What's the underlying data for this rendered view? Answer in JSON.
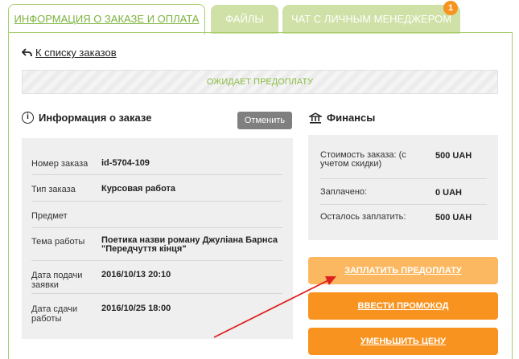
{
  "tabs": {
    "order_info": "ИНФОРМАЦИЯ О ЗАКАЗЕ И ОПЛАТА",
    "files": "ФАЙЛЫ",
    "chat": "ЧАТ С ЛИЧНЫМ МЕНЕДЖЕРОМ",
    "chat_badge": "1"
  },
  "back_link": "К списку заказов",
  "status": "ОЖИДАЕТ ПРЕДОПЛАТУ",
  "order_section": {
    "title": "Информация о заказе",
    "cancel": "Отменить",
    "rows": [
      {
        "label": "Номер заказа",
        "value": "id-5704-109"
      },
      {
        "label": "Тип заказа",
        "value": "Курсовая работа"
      },
      {
        "label": "Предмет",
        "value": ""
      },
      {
        "label": "Тема работы",
        "value": "Поетика назви роману Джуліана Барнса \"Передчуття кінця\""
      },
      {
        "label": "Дата подачи заявки",
        "value": "2016/10/13 20:10"
      },
      {
        "label": "Дата сдачи работы",
        "value": "2016/10/25 18:00"
      }
    ]
  },
  "finance_section": {
    "title": "Финансы",
    "rows": [
      {
        "label": "Стоимость заказа: (с учетом скидки)",
        "value": "500 UAH"
      },
      {
        "label": "Заплачено:",
        "value": "0 UAH"
      },
      {
        "label": "Осталось заплатить:",
        "value": "500 UAH"
      }
    ]
  },
  "buttons": {
    "pay": "ЗАПЛАТИТЬ ПРЕДОПЛАТУ",
    "promo": "ВВЕСТИ ПРОМОКОД",
    "reduce": "УМЕНЬШИТЬ ЦЕНУ"
  },
  "colors": {
    "accent_green": "#7bb33c",
    "tab_inactive": "#cfe1a6",
    "orange": "#f7931e",
    "orange_light": "#fbb860",
    "arrow": "#e02020"
  }
}
